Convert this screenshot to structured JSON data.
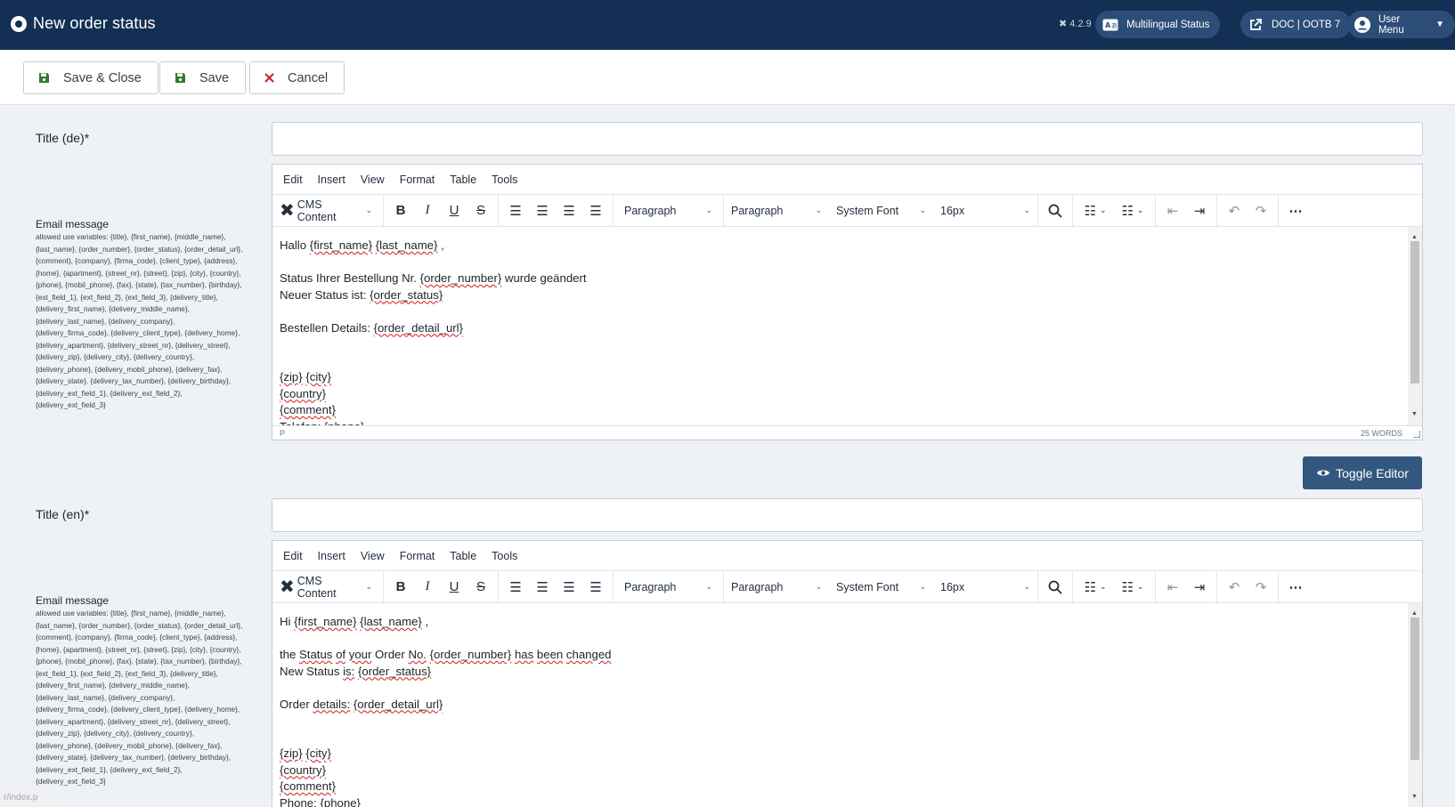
{
  "header": {
    "title": "New order status",
    "version": "4.2.9",
    "multilingual_label": "Multilingual Status",
    "doc_label": "DOC | OOTB 7",
    "user_menu_label": "User Menu"
  },
  "toolbar": {
    "save_close_label": "Save & Close",
    "save_label": "Save",
    "cancel_label": "Cancel"
  },
  "form": {
    "title_de_label": "Title (de)*",
    "title_en_label": "Title (en)*",
    "title_de_value": "",
    "title_en_value": "",
    "email_message_label": "Email message",
    "allowed_vars": "allowed use variables: {title}, {first_name}, {middle_name}, {last_name}, {order_number}, {order_status}, {order_detail_url}, {comment}, {company}, {firma_code}, {client_type}, {address}, {home}, {apartment}, {street_nr}, {street}, {zip}, {city}, {country}, {phone}, {mobil_phone}, {fax}, {state}, {tax_number}, {birthday}, {ext_field_1}, {ext_field_2}, {ext_field_3}, {delivery_title}, {delivery_first_name}, {delivery_middle_name}, {delivery_last_name}, {delivery_company}, {delivery_firma_code}, {delivery_client_type}, {delivery_home}, {delivery_apartment}, {delivery_street_nr}, {delivery_street}, {delivery_zip}, {delivery_city}, {delivery_country}, {delivery_phone}, {delivery_mobil_phone}, {delivery_fax}, {delivery_state}, {delivery_tax_number}, {delivery_birthday}, {delivery_ext_field_1}, {delivery_ext_field_2}, {delivery_ext_field_3}",
    "toggle_editor_label": "Toggle Editor"
  },
  "editor": {
    "menus": [
      "Edit",
      "Insert",
      "View",
      "Format",
      "Table",
      "Tools"
    ],
    "cms_content": "CMS Content",
    "block_format": "Paragraph",
    "block_format_2": "Paragraph",
    "font_family": "System Font",
    "font_size": "16px",
    "status_path": "P",
    "word_count": "25 WORDS"
  },
  "editor_de": {
    "lines": [
      [
        "Hallo ",
        "~{first_name}",
        " ",
        "~{last_name}",
        " ,"
      ],
      [
        ""
      ],
      [
        "Status Ihrer Bestellung Nr. ",
        "~{order_number}",
        " wurde geändert"
      ],
      [
        "Neuer Status ist: ",
        "~{order_status}"
      ],
      [
        ""
      ],
      [
        "Bestellen Details: ",
        "~{order_detail_url}"
      ],
      [
        ""
      ],
      [
        ""
      ],
      [
        "~{zip}",
        " ",
        "~{city}"
      ],
      [
        "~{country}"
      ],
      [
        "~{comment}"
      ],
      [
        "Telefon: ",
        "~{phone}"
      ]
    ]
  },
  "editor_en": {
    "lines": [
      [
        "Hi ",
        "~{first_name}",
        " ",
        "~{last_name}",
        " ,"
      ],
      [
        ""
      ],
      [
        "the ",
        "~Status",
        " ",
        "~of",
        " ",
        "~your",
        " Order ",
        "~No.",
        " ",
        "~{order_number}",
        " ",
        "~has",
        " ",
        "~been",
        " ",
        "~changed"
      ],
      [
        "New Status ",
        "~is:",
        " ",
        "~{order_status}"
      ],
      [
        ""
      ],
      [
        "Order ",
        "~details:",
        " ",
        "~{order_detail_url}"
      ],
      [
        ""
      ],
      [
        ""
      ],
      [
        "~{zip}",
        " ",
        "~{city}"
      ],
      [
        "~{country}"
      ],
      [
        "~{comment}"
      ],
      [
        "Phone: ",
        "~{phone}"
      ]
    ]
  },
  "url_hint": "r/index.p",
  "colors": {
    "header_bg": "#132f53",
    "header_pill": "#2c4d77",
    "toggle_btn": "#33577f",
    "save_icon": "#2e7d32",
    "cancel_icon": "#c62828"
  }
}
